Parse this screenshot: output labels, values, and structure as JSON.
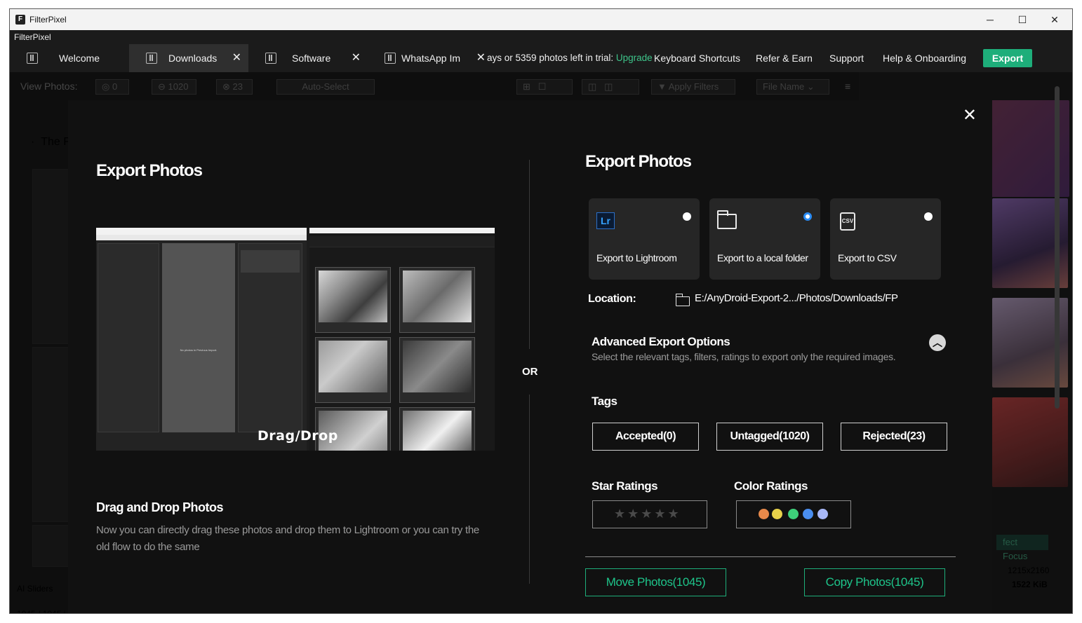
{
  "window": {
    "title": "FilterPixel",
    "menu_label": "FilterPixel",
    "minimize": "─",
    "maximize": "☐",
    "close": "✕"
  },
  "tabs": [
    {
      "label": "Welcome",
      "active": false,
      "closable": false
    },
    {
      "label": "Downloads",
      "active": true,
      "closable": true
    },
    {
      "label": "Software",
      "active": false,
      "closable": true
    },
    {
      "label": "WhatsApp Im",
      "active": false,
      "closable": true
    }
  ],
  "tab_close_glyph": "✕",
  "nav": {
    "trial_text": "ays or 5359 photos left in trial:",
    "upgrade": "Upgrade",
    "keyboard_shortcuts": "Keyboard Shortcuts",
    "refer_earn": "Refer & Earn",
    "support": "Support",
    "help_onboarding": "Help & Onboarding",
    "export": "Export"
  },
  "background": {
    "view_photos": "View Photos:",
    "count_accepted": "0",
    "count_untagged": "1020",
    "count_rejected": "23",
    "auto_select": "Auto-Select",
    "apply_filters": "Apply Filters",
    "file_name": "File Name",
    "breadcrumb_partial": "The F",
    "ai_sliders": "AI Sliders",
    "photo_counter": "1045 / 1045 i",
    "perfect_focus_partial": "fect Focus",
    "image_dimensions": "1215x2160",
    "image_size": "1522 KiB"
  },
  "modal": {
    "close_glyph": "✕",
    "left_heading": "Export Photos",
    "preview_caption": "Drag/Drop",
    "preview_placeholder_text": "No photos in Previous Import.",
    "dd_heading": "Drag and Drop Photos",
    "dd_description": "Now you can directly drag these photos and drop them to Lightroom or you can try the old flow to do the same",
    "or_label": "OR",
    "right_heading": "Export Photos",
    "options": [
      {
        "label": "Export to Lightroom",
        "icon": "lightroom-icon",
        "icon_text": "Lr",
        "selected": false
      },
      {
        "label": "Export to a local folder",
        "icon": "folder-icon",
        "selected": true
      },
      {
        "label": "Export to CSV",
        "icon": "csv-file-icon",
        "icon_text": "CSV",
        "selected": false
      }
    ],
    "location_label": "Location:",
    "location_path": "E:/AnyDroid-Export-2.../Photos/Downloads/FP",
    "advanced_title": "Advanced Export Options",
    "advanced_desc": "Select the relevant tags, filters, ratings to export only the required images.",
    "tags_title": "Tags",
    "tags": [
      {
        "label": "Accepted(0)"
      },
      {
        "label": "Untagged(1020)"
      },
      {
        "label": "Rejected(23)"
      }
    ],
    "star_ratings_title": "Star Ratings",
    "stars": "★★★★★",
    "color_ratings_title": "Color Ratings",
    "color_dots": [
      "#e8894a",
      "#e8d24a",
      "#3ed07a",
      "#4a8ef0",
      "#a8b8f8"
    ],
    "move_button": "Move Photos(1045)",
    "copy_button": "Copy Photos(1045)"
  },
  "colors": {
    "accent_green": "#1eae7a",
    "radio_blue": "#2a8cf5",
    "modal_bg": "#111111",
    "card_bg": "#262626"
  }
}
